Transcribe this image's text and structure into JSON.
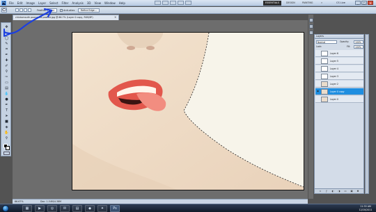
{
  "app": {
    "logo": "Ps",
    "menus": [
      "File",
      "Edit",
      "Image",
      "Layer",
      "Select",
      "Filter",
      "Analysis",
      "3D",
      "View",
      "Window",
      "Help"
    ],
    "workspaces": [
      "ESSENTIALS",
      "DESIGN",
      "PAINTING",
      "»"
    ],
    "cs_live": "CS Live"
  },
  "options_bar": {
    "feather_label": "Feather:",
    "feather_value": "0 px",
    "antialias_label": "Anti-alias",
    "refine_edge_label": "Refine Edge..."
  },
  "document": {
    "tab_title": "chicksmouth pownered-pasted.jpg @ 66.7% (Layer 0 copy, RGB/8*)",
    "tab_close": "×"
  },
  "status_bar": {
    "zoom": "66.67%",
    "doc_size": "Doc: 1.54M/4.38M"
  },
  "layers_panel": {
    "title": "Layers",
    "blend_mode": "Normal",
    "opacity_label": "Opacity:",
    "opacity_value": "100%",
    "lock_label": "Lock:",
    "fill_label": "Fill:",
    "fill_value": "100%",
    "layers": [
      {
        "name": "Layer 6"
      },
      {
        "name": "Layer 5"
      },
      {
        "name": "Layer 4"
      },
      {
        "name": "Layer 3"
      },
      {
        "name": "Layer 2"
      },
      {
        "name": "Layer 0 copy"
      },
      {
        "name": "Layer 0"
      }
    ],
    "selected_layer": "Layer 0 copy"
  },
  "taskbar": {
    "time": "11:35 AM",
    "date": "12/20/2011"
  },
  "colors": {
    "selection_highlight": "#1f8ee0",
    "annotation_blue": "#1b3fe0",
    "lips": "#e2574c"
  },
  "icons": [
    "close-icon",
    "minimize-icon",
    "maximize-icon",
    "eye-icon",
    "lasso-icon",
    "move-icon",
    "brush-icon",
    "trash-icon"
  ]
}
